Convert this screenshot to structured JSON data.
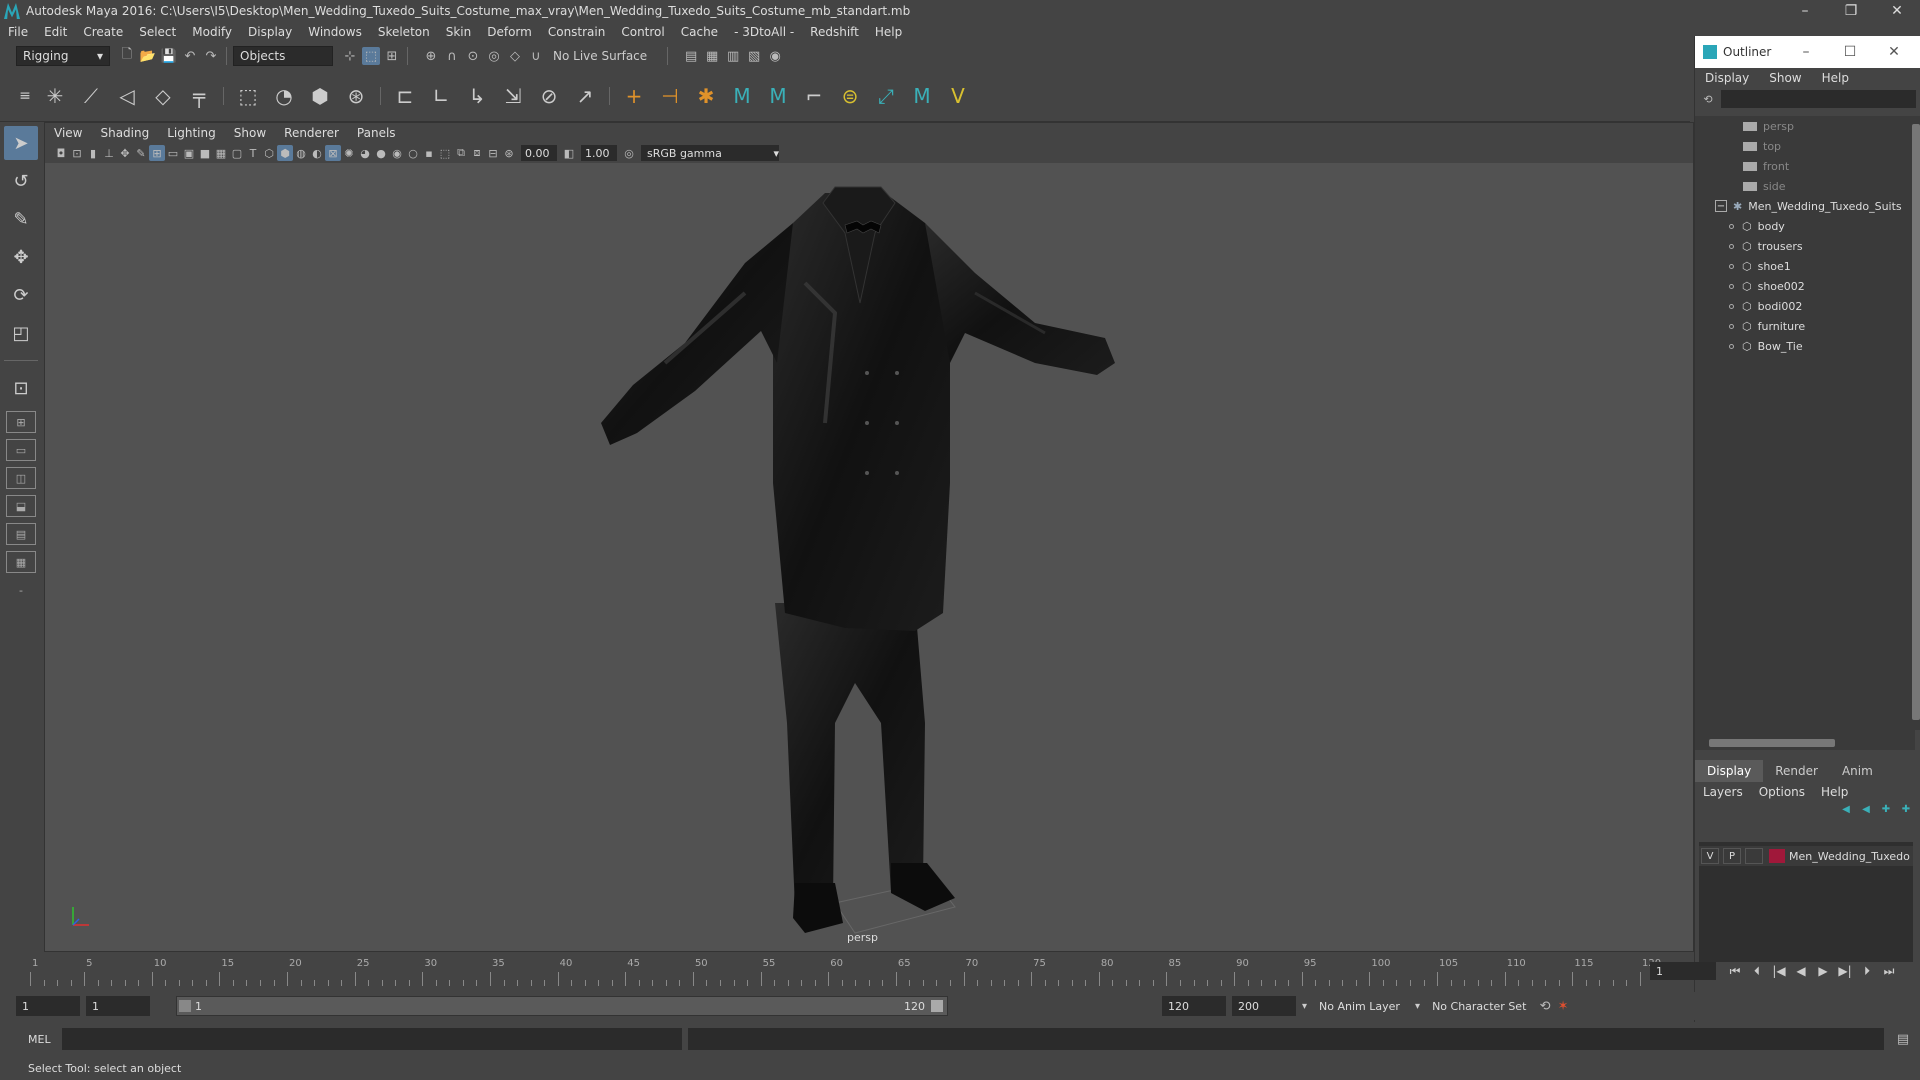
{
  "window": {
    "title": "Autodesk Maya 2016: C:\\Users\\I5\\Desktop\\Men_Wedding_Tuxedo_Suits_Costume_max_vray\\Men_Wedding_Tuxedo_Suits_Costume_mb_standart.mb",
    "min": "–",
    "max": "❐",
    "close": "✕"
  },
  "menubar": [
    "File",
    "Edit",
    "Create",
    "Select",
    "Modify",
    "Display",
    "Windows",
    "Skeleton",
    "Skin",
    "Deform",
    "Constrain",
    "Control",
    "Cache",
    "- 3DtoAll -",
    "Redshift",
    "Help"
  ],
  "statusline": {
    "mode": "Rigging",
    "selection_mode": "Objects",
    "live_surface": "No Live Surface"
  },
  "viewport": {
    "menu": [
      "View",
      "Shading",
      "Lighting",
      "Show",
      "Renderer",
      "Panels"
    ],
    "exposure": "0.00",
    "gamma": "1.00",
    "color_space": "sRGB gamma",
    "camera_label": "persp"
  },
  "outliner": {
    "title": "Outliner",
    "menu": [
      "Display",
      "Show",
      "Help"
    ],
    "cameras": [
      "persp",
      "top",
      "front",
      "side"
    ],
    "group": "Men_Wedding_Tuxedo_Suits",
    "children": [
      "body",
      "trousers",
      "shoe1",
      "shoe002",
      "bodi002",
      "furniture",
      "Bow_Tie"
    ]
  },
  "layers": {
    "tabs": [
      "Display",
      "Render",
      "Anim"
    ],
    "menu": [
      "Layers",
      "Options",
      "Help"
    ],
    "row": {
      "v": "V",
      "p": "P",
      "name": "Men_Wedding_Tuxedo",
      "color": "#a0183a"
    }
  },
  "timeline": {
    "labels": [
      "1",
      "5",
      "10",
      "15",
      "20",
      "25",
      "30",
      "35",
      "40",
      "45",
      "50",
      "55",
      "60",
      "65",
      "70",
      "75",
      "80",
      "85",
      "90",
      "95",
      "100",
      "105",
      "110",
      "115",
      "120"
    ],
    "current_frame": "1"
  },
  "range": {
    "start": "1",
    "playback_start": "1",
    "slider_start": "1",
    "slider_end": "120",
    "playback_end": "120",
    "end": "200",
    "anim_layer": "No Anim Layer",
    "char_set": "No Character Set"
  },
  "cmdline": {
    "label": "MEL"
  },
  "help": {
    "text": "Select Tool: select an object"
  }
}
